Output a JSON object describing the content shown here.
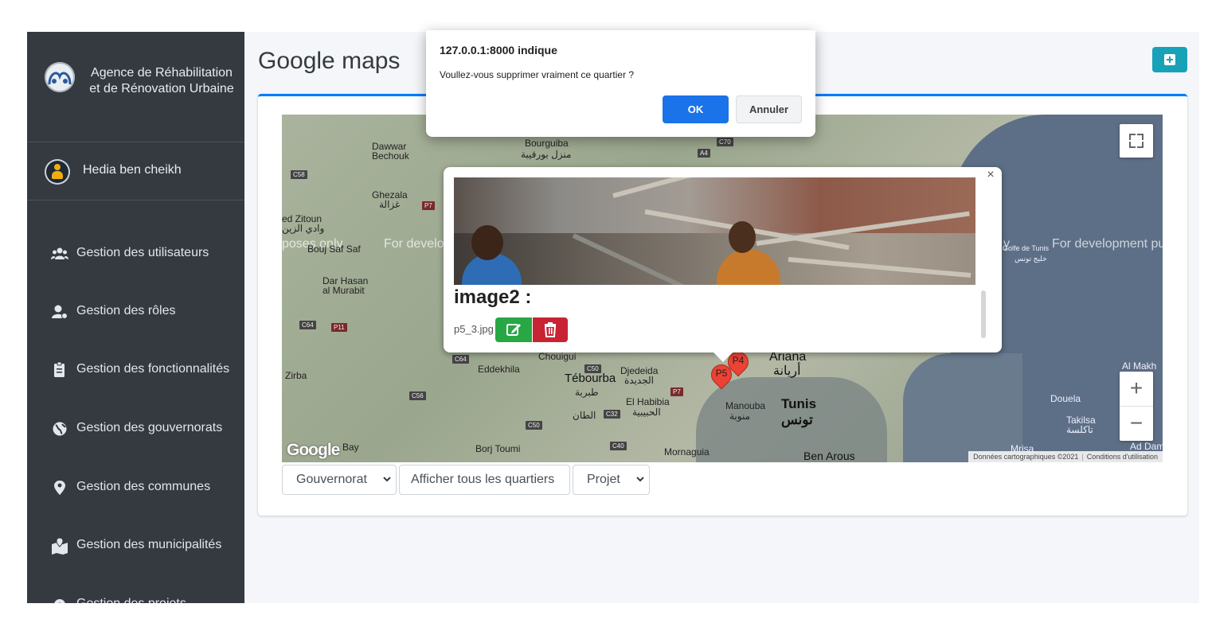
{
  "sidebar": {
    "brand": {
      "line1": "Agence de Réhabilitation",
      "line2": "et de Rénovation Urbaine"
    },
    "user_name": "Hedia ben cheikh",
    "items": [
      {
        "label": "Gestion des utilisateurs",
        "icon": "users-icon"
      },
      {
        "label": "Gestion des rôles",
        "icon": "user-role-icon"
      },
      {
        "label": "Gestion des fonctionnalités",
        "icon": "clipboard-icon"
      },
      {
        "label": "Gestion des gouvernorats",
        "icon": "globe-icon"
      },
      {
        "label": "Gestion des communes",
        "icon": "map-marker-icon"
      },
      {
        "label": "Gestion des municipalités",
        "icon": "map-location-icon"
      },
      {
        "label": "Gestion des projets",
        "icon": "cog-icon"
      }
    ]
  },
  "header": {
    "title": "Google maps"
  },
  "map": {
    "watermarks": [
      "poses only",
      "For develo",
      "y",
      "For development pu"
    ],
    "labels": {
      "bourguiba": "Bourguiba",
      "bourguiba_ar": "منزل بورقيبة",
      "dawwar": "Dawwar",
      "bechouk": "Bechouk",
      "ghezala": "Ghezala",
      "ghezala_ar": "غزالة",
      "zitoun": "ed Zitoun",
      "zitoun_ar": "وادي الزين",
      "boujsaf": "Bouj Saf Saf",
      "darhasan": "Dar Hasan",
      "almurabit": "al Murabit",
      "zirba": "Zirba",
      "eddekhila": "Eddekhila",
      "chouigui": "Chouigui",
      "tebourba": "Tébourba",
      "tebourba_ar": "طبربة",
      "djedeida": "Djedeida",
      "djedeida_ar": "الجديدة",
      "elhabibia": "El Habibia",
      "elhabibia_ar": "الحبيبية",
      "eltaan": "الطان",
      "ariana": "Ariana",
      "ariana_ar": "أريانة",
      "manouba": "Manouba",
      "manouba_ar": "منوبة",
      "tunis": "Tunis",
      "tunis_ar": "تونس",
      "borjtoumi": "Borj Toumi",
      "mornaguia": "Mornaguia",
      "benarous": "Ben Arous",
      "douela": "Douela",
      "takilsa": "Takilsa",
      "takilsa_ar": "تاكلسة",
      "almakh": "Al Makh",
      "addam": "Ad Dam",
      "golfe": "Golfe de Tunis",
      "golfe_ar": "خليج تونس",
      "mrisa": "Mrisa",
      "postal": "Bay"
    },
    "roads": [
      "C58",
      "P7",
      "A4",
      "C70",
      "C64",
      "P11",
      "C64",
      "C50",
      "P7",
      "C56",
      "C50",
      "C32",
      "C40"
    ],
    "markers": [
      "P5",
      "P4"
    ],
    "google": "Google",
    "footer": {
      "data": "Données cartographiques ©2021",
      "terms": "Conditions d'utilisation"
    }
  },
  "infowindow": {
    "close": "×",
    "title": "image2 :",
    "filename": "p5_3.jpg"
  },
  "filters": {
    "gouvernorat": "Gouvernorat",
    "show_all": "Afficher tous les quartiers",
    "projet": "Projet"
  },
  "dialog": {
    "title": "127.0.0.1:8000 indique",
    "message": "Voullez-vous supprimer vraiment ce quartier ?",
    "ok": "OK",
    "cancel": "Annuler"
  },
  "colors": {
    "sidebar": "#343a40",
    "primary": "#007bff",
    "info": "#17a2b8",
    "success": "#28a745",
    "danger": "#c82333",
    "dialog_ok": "#1a73e8"
  }
}
